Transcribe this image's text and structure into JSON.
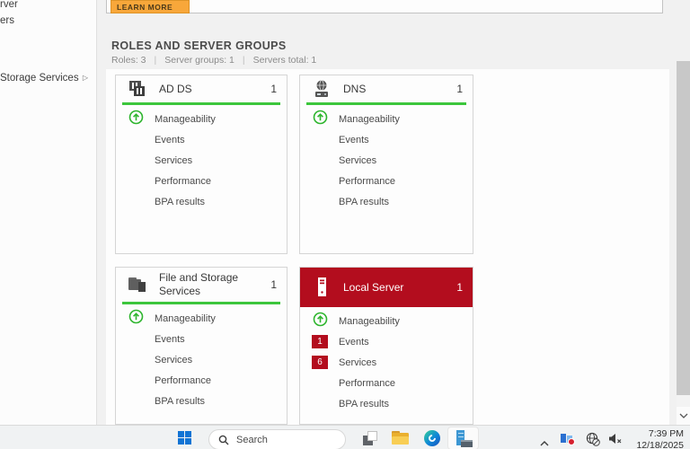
{
  "colors": {
    "alert_red": "#b30d1e",
    "accent_green": "#3cc63c",
    "button_orange": "#f8a73a",
    "taskbar_bg": "#f0f2f3"
  },
  "sidebar": {
    "items": [
      {
        "label": "rver"
      },
      {
        "label": "ers"
      },
      {
        "label": "Storage Services",
        "arrow": "▷"
      }
    ]
  },
  "banner": {
    "learn_more": "LEARN MORE"
  },
  "section": {
    "title": "ROLES AND SERVER GROUPS",
    "stats": [
      "Roles: 3",
      "Server groups: 1",
      "Servers total: 1"
    ],
    "separator": "|"
  },
  "tiles": [
    {
      "title": "AD DS",
      "count": "1",
      "rows": [
        {
          "label": "Manageability"
        },
        {
          "label": "Events"
        },
        {
          "label": "Services"
        },
        {
          "label": "Performance"
        },
        {
          "label": "BPA results"
        }
      ]
    },
    {
      "title": "DNS",
      "count": "1",
      "rows": [
        {
          "label": "Manageability"
        },
        {
          "label": "Events"
        },
        {
          "label": "Services"
        },
        {
          "label": "Performance"
        },
        {
          "label": "BPA results"
        }
      ]
    },
    {
      "title": "File and Storage Services",
      "count": "1",
      "rows": [
        {
          "label": "Manageability"
        },
        {
          "label": "Events"
        },
        {
          "label": "Services"
        },
        {
          "label": "Performance"
        },
        {
          "label": "BPA results"
        }
      ]
    },
    {
      "title": "Local Server",
      "count": "1",
      "alert": true,
      "rows": [
        {
          "label": "Manageability"
        },
        {
          "label": "Events",
          "badge": "1"
        },
        {
          "label": "Services",
          "badge": "6"
        },
        {
          "label": "Performance"
        },
        {
          "label": "BPA results"
        }
      ]
    }
  ],
  "taskbar": {
    "search": "Search",
    "clock": {
      "time": "7:39 PM",
      "date": "12/18/2025"
    }
  }
}
